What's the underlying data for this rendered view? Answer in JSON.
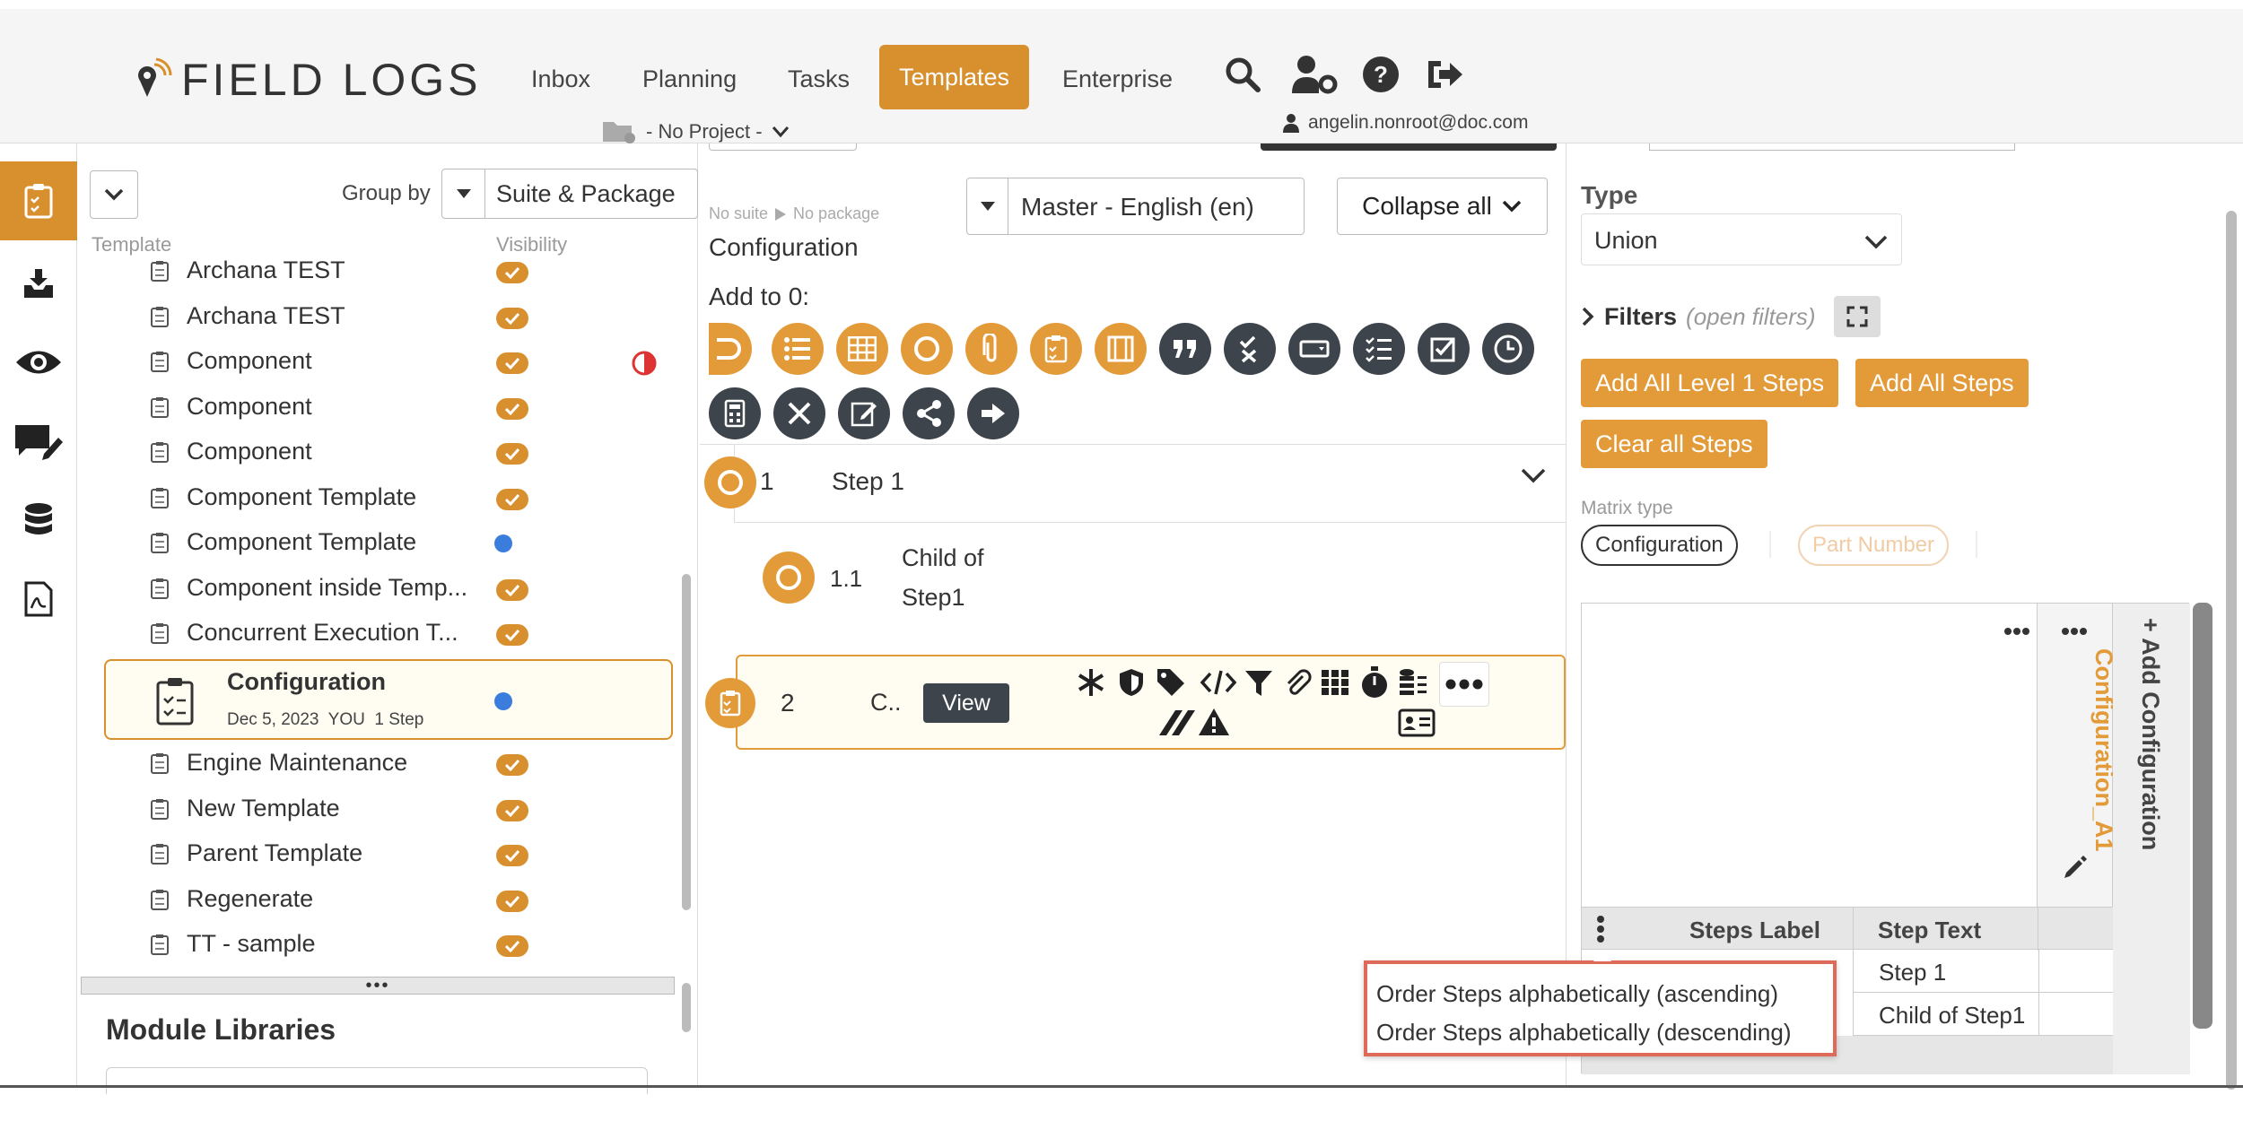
{
  "header": {
    "logo_text": "FIELD LOGS",
    "nav": [
      "Inbox",
      "Planning",
      "Tasks",
      "Templates",
      "Enterprise"
    ],
    "active_nav": "Templates",
    "project": "- No Project -",
    "user": "angelin.nonroot@doc.com"
  },
  "left_panel": {
    "group_by_label": "Group by",
    "group_by_value": "Suite & Package",
    "col_template": "Template",
    "col_visibility": "Visibility",
    "templates_before": [
      {
        "name": "Archana TEST",
        "visibility": "check"
      },
      {
        "name": "Archana TEST",
        "visibility": "check"
      },
      {
        "name": "Component",
        "visibility": "check",
        "warning": true
      },
      {
        "name": "Component",
        "visibility": "check"
      },
      {
        "name": "Component",
        "visibility": "check"
      },
      {
        "name": "Component Template",
        "visibility": "check"
      },
      {
        "name": "Component Template",
        "visibility": "dot"
      },
      {
        "name": "Component inside Temp...",
        "visibility": "check"
      },
      {
        "name": "Concurrent Execution T...",
        "visibility": "check"
      }
    ],
    "selected": {
      "name": "Configuration",
      "meta": "Dec 5, 2023  YOU  1 Step",
      "visibility": "dot"
    },
    "templates_after": [
      {
        "name": "Engine Maintenance",
        "visibility": "check"
      },
      {
        "name": "New Template",
        "visibility": "check"
      },
      {
        "name": "Parent Template",
        "visibility": "check"
      },
      {
        "name": "Regenerate",
        "visibility": "check"
      },
      {
        "name": "TT - sample",
        "visibility": "check"
      }
    ],
    "module_libraries": "Module Libraries"
  },
  "center": {
    "breadcrumb_suite": "No suite",
    "breadcrumb_package": "No package",
    "title": "Configuration",
    "language": "Master - English (en)",
    "collapse_label": "Collapse all",
    "add_to_label": "Add to 0:",
    "steps": [
      {
        "num": "1",
        "label": "Step 1"
      },
      {
        "num": "1.1",
        "label": "Child of Step1"
      },
      {
        "num": "2",
        "label": "C..",
        "view_label": "View"
      }
    ]
  },
  "right": {
    "type_label": "Type",
    "type_value": "Union",
    "filters_label": "Filters",
    "filters_hint": "(open filters)",
    "btn_add_level1": "Add All Level 1 Steps",
    "btn_add_all": "Add All Steps",
    "btn_clear": "Clear all Steps",
    "matrix_type_label": "Matrix type",
    "matrix_opts": [
      "Configuration",
      "Part Number"
    ],
    "col_header_vertical": "Configuration_A1",
    "add_config": "+ Add Configuration",
    "table_headers": [
      "Steps Label",
      "Step Text"
    ],
    "table_rows": [
      "Step 1",
      "Child of Step1"
    ]
  },
  "context_menu": {
    "asc": "Order Steps alphabetically (ascending)",
    "desc": "Order Steps alphabetically (descending)"
  }
}
